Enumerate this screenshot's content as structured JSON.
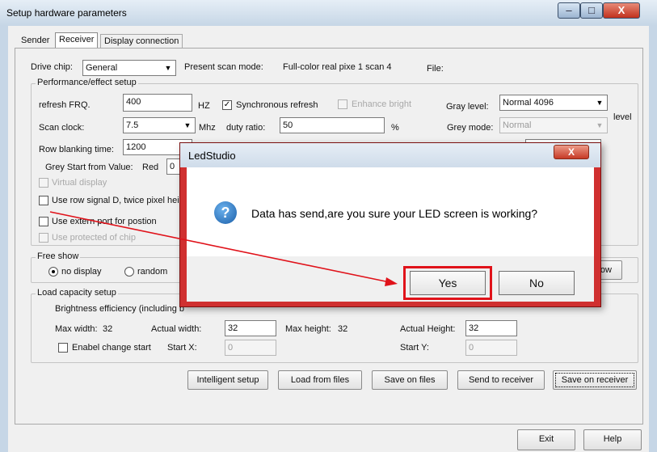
{
  "window": {
    "title": "Setup hardware parameters",
    "min_glyph": "–",
    "max_glyph": "□",
    "close_glyph": "X"
  },
  "tabs": [
    "Sender",
    "Receiver",
    "Display connection"
  ],
  "active_tab": "Receiver",
  "top": {
    "drive_chip_label": "Drive chip:",
    "drive_chip_value": "General",
    "present_scan_label": "Present scan mode:",
    "present_scan_value": "Full-color real pixe 1 scan 4",
    "file_label": "File:"
  },
  "performance": {
    "title": "Performance/effect setup",
    "refresh_label": "refresh FRQ.",
    "refresh_value": "400",
    "hz_unit": "HZ",
    "sync_refresh_label": "Synchronous refresh",
    "sync_refresh_checked": true,
    "enhance_bright_label": "Enhance bright",
    "gray_level_label": "Gray level:",
    "gray_level_value": "Normal 4096",
    "level_suffix": "level",
    "scan_clock_label": "Scan clock:",
    "scan_clock_value": "7.5",
    "mhz_unit": "Mhz",
    "duty_ratio_label": "duty ratio:",
    "duty_ratio_value": "50",
    "percent_unit": "%",
    "grey_mode_label": "Grey mode:",
    "grey_mode_value": "Normal",
    "row_blanking_label": "Row blanking time:",
    "row_blanking_value": "1200",
    "grey_start_label": "Grey Start from Value:",
    "grey_start_color": "Red",
    "grey_start_value": "0",
    "virtual_display_label": "Virtual display",
    "row_signal_label": "Use row signal D, twice pixel heig",
    "extern_port_label": "Use extern port for postion",
    "protected_chip_label": "Use protected of chip"
  },
  "free_show": {
    "title": "Free show",
    "no_display_label": "no display",
    "random_label": "random",
    "test_now_label": "st now"
  },
  "load_capacity": {
    "title": "Load capacity setup",
    "brightness_label": "Brightness efficiency (including b",
    "max_width_label": "Max width:",
    "max_width_value": "32",
    "actual_width_label": "Actual width:",
    "actual_width_value": "32",
    "max_height_label": "Max height:",
    "max_height_value": "32",
    "actual_height_label": "Actual Height:",
    "actual_height_value": "32",
    "enable_change_label": "Enabel change start",
    "start_x_label": "Start X:",
    "start_x_value": "0",
    "start_y_label": "Start Y:",
    "start_y_value": "0"
  },
  "actions": {
    "intelligent_setup": "Intelligent setup",
    "load_from_files": "Load from files",
    "save_on_files": "Save on files",
    "send_to_receiver": "Send to receiver",
    "save_on_receiver": "Save on receiver"
  },
  "bottom": {
    "exit": "Exit",
    "help": "Help"
  },
  "dialog": {
    "title": "LedStudio",
    "close_glyph": "X",
    "icon_glyph": "?",
    "message": "Data has send,are you sure your LED screen is working?",
    "yes": "Yes",
    "no": "No"
  },
  "colors": {
    "annotation_red": "#e0121a",
    "title_bar": "#c6d6e6",
    "client_bg": "#f0f0f0"
  }
}
